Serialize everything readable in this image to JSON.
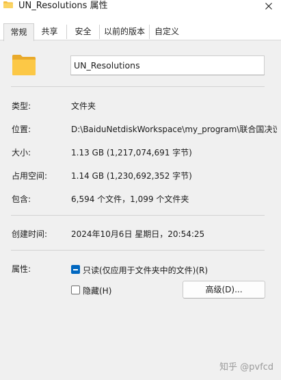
{
  "window": {
    "title": "UN_Resolutions 属性",
    "close_icon": "close-icon"
  },
  "tabs": [
    {
      "label": "常规",
      "active": true
    },
    {
      "label": "共享"
    },
    {
      "label": "安全"
    },
    {
      "label": "以前的版本"
    },
    {
      "label": "自定义"
    }
  ],
  "general": {
    "folder_name": "UN_Resolutions",
    "rows": [
      {
        "label": "类型:",
        "value": "文件夹"
      },
      {
        "label": "位置:",
        "value": "D:\\BaiduNetdiskWorkspace\\my_program\\联合国决议"
      },
      {
        "label": "大小:",
        "value": "1.13 GB (1,217,074,691 字节)"
      },
      {
        "label": "占用空间:",
        "value": "1.14 GB (1,230,692,352 字节)"
      },
      {
        "label": "包含:",
        "value": "6,594 个文件，1,099 个文件夹"
      },
      {
        "label": "创建时间:",
        "value": "2024年10月6日 星期日，20:54:25"
      }
    ],
    "attributes": {
      "label": "属性:",
      "readonly_label": "只读(仅应用于文件夹中的文件)(R)",
      "readonly_state": "mixed",
      "hidden_label": "隐藏(H)",
      "hidden_state": "unchecked",
      "advanced_label": "高级(D)..."
    }
  },
  "watermark": "知乎 @pvfcd",
  "colors": {
    "accent": "#0067c0",
    "folder": "#f6c244"
  }
}
